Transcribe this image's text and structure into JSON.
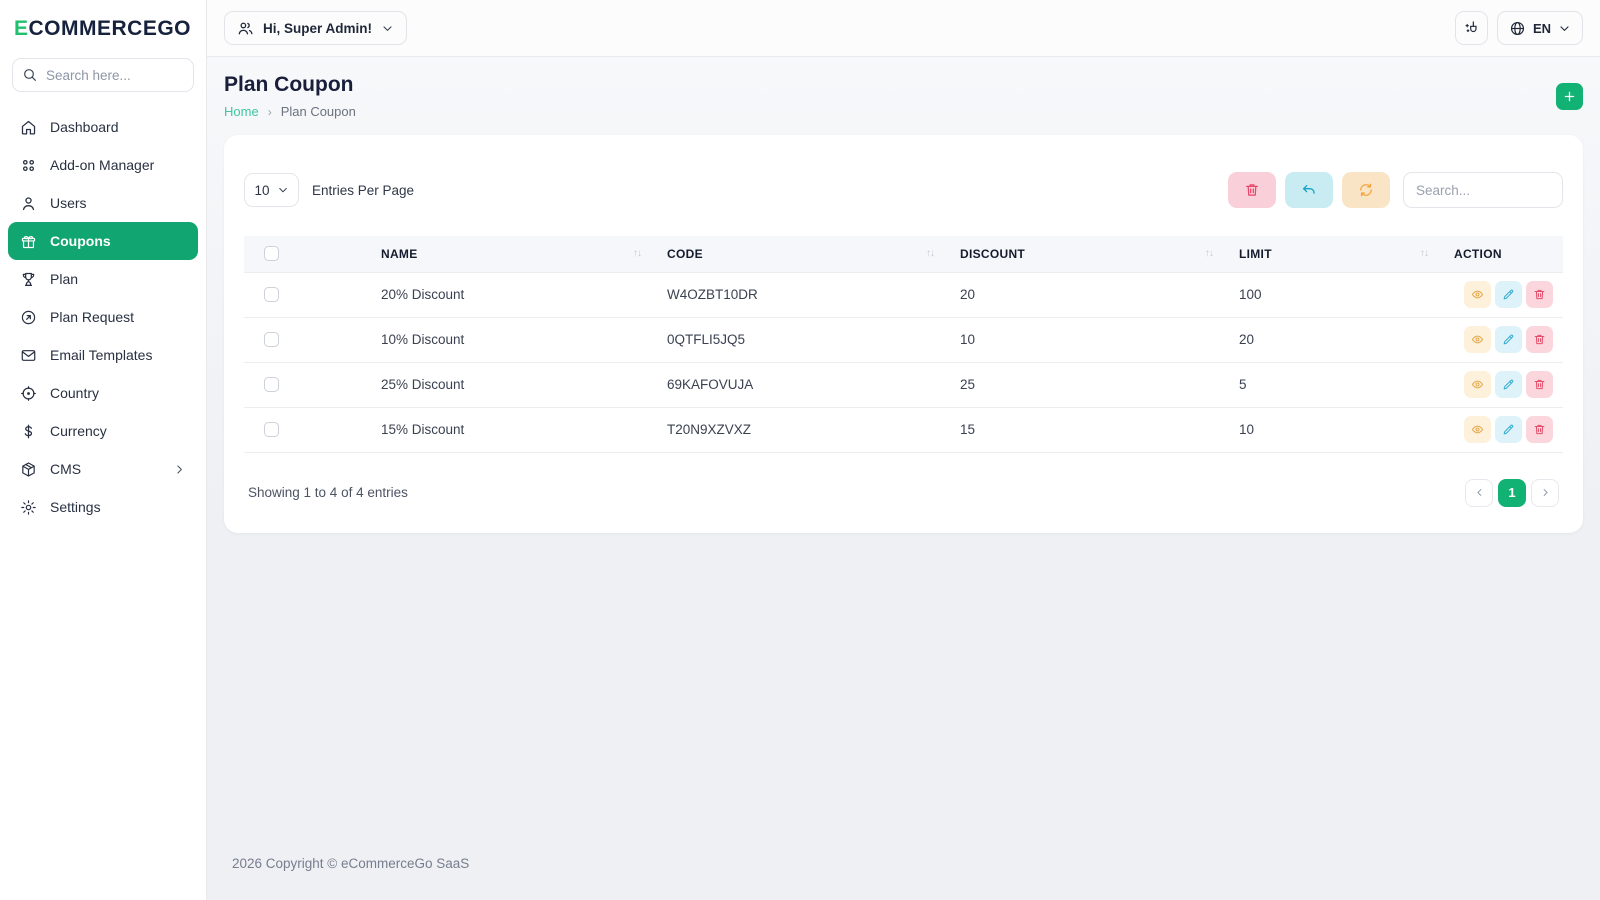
{
  "brand": {
    "logo_prefix": "E",
    "logo_rest": "COMMERCEGO"
  },
  "sidebar": {
    "search_placeholder": "Search here...",
    "items": [
      {
        "label": "Dashboard",
        "icon": "home-icon",
        "active": false
      },
      {
        "label": "Add-on Manager",
        "icon": "grid-icon",
        "active": false
      },
      {
        "label": "Users",
        "icon": "user-icon",
        "active": false
      },
      {
        "label": "Coupons",
        "icon": "gift-icon",
        "active": true
      },
      {
        "label": "Plan",
        "icon": "trophy-icon",
        "active": false
      },
      {
        "label": "Plan Request",
        "icon": "arrow-up-right-icon",
        "active": false
      },
      {
        "label": "Email Templates",
        "icon": "envelope-icon",
        "active": false
      },
      {
        "label": "Country",
        "icon": "target-icon",
        "active": false
      },
      {
        "label": "Currency",
        "icon": "dollar-icon",
        "active": false
      },
      {
        "label": "CMS",
        "icon": "package-icon",
        "active": false,
        "has_submenu": true
      },
      {
        "label": "Settings",
        "icon": "gear-icon",
        "active": false
      }
    ]
  },
  "topbar": {
    "user_button_label": "Hi, Super Admin!",
    "user_icon": "users-icon",
    "cache_icon": "broom-icon",
    "language_icon": "globe-icon",
    "language": "EN"
  },
  "page": {
    "title": "Plan Coupon",
    "breadcrumb": {
      "home": "Home",
      "separator": "›",
      "current": "Plan Coupon"
    },
    "add_button_icon": "plus-icon"
  },
  "table_controls": {
    "entries_value": "10",
    "entries_label": "Entries Per Page",
    "search_placeholder": "Search...",
    "bulk_buttons": [
      "trash-icon",
      "undo-icon",
      "refresh-icon"
    ]
  },
  "table": {
    "sort_glyph": "↑↓",
    "columns": {
      "name": "NAME",
      "code": "CODE",
      "discount": "DISCOUNT",
      "limit": "LIMIT",
      "action": "ACTION"
    },
    "row_action_icons": [
      "eye-icon",
      "pencil-icon",
      "trash-icon"
    ],
    "rows": [
      {
        "name": "20% Discount",
        "code": "W4OZBT10DR",
        "discount": "20",
        "limit": "100"
      },
      {
        "name": "10% Discount",
        "code": "0QTFLI5JQ5",
        "discount": "10",
        "limit": "20"
      },
      {
        "name": "25% Discount",
        "code": "69KAFOVUJA",
        "discount": "25",
        "limit": "5"
      },
      {
        "name": "15% Discount",
        "code": "T20N9XZVXZ",
        "discount": "15",
        "limit": "10"
      }
    ],
    "summary": "Showing 1 to 4 of 4 entries",
    "pagination": {
      "current": "1"
    }
  },
  "footer": {
    "copyright": "2026 Copyright © eCommerceGo SaaS"
  },
  "colors": {
    "primary_green": "#10A571",
    "accent_green": "#12B274",
    "logo_green": "#1FC06E",
    "breadcrumb_link": "#3FC79F",
    "bulk_delete_bg": "#F9CFD9",
    "bulk_delete_icon": "#E8476B",
    "undo_bg": "#C9ECF2",
    "undo_icon": "#15A4C4",
    "refresh_bg": "#FAE4C6",
    "refresh_icon": "#F3A43E",
    "action_view_bg": "#FDF1DC",
    "action_view_icon": "#E3A94D",
    "action_edit_bg": "#DEF2F9",
    "action_edit_icon": "#39AED0",
    "action_delete_bg": "#FBD6DD",
    "action_delete_icon": "#E34F6B"
  }
}
